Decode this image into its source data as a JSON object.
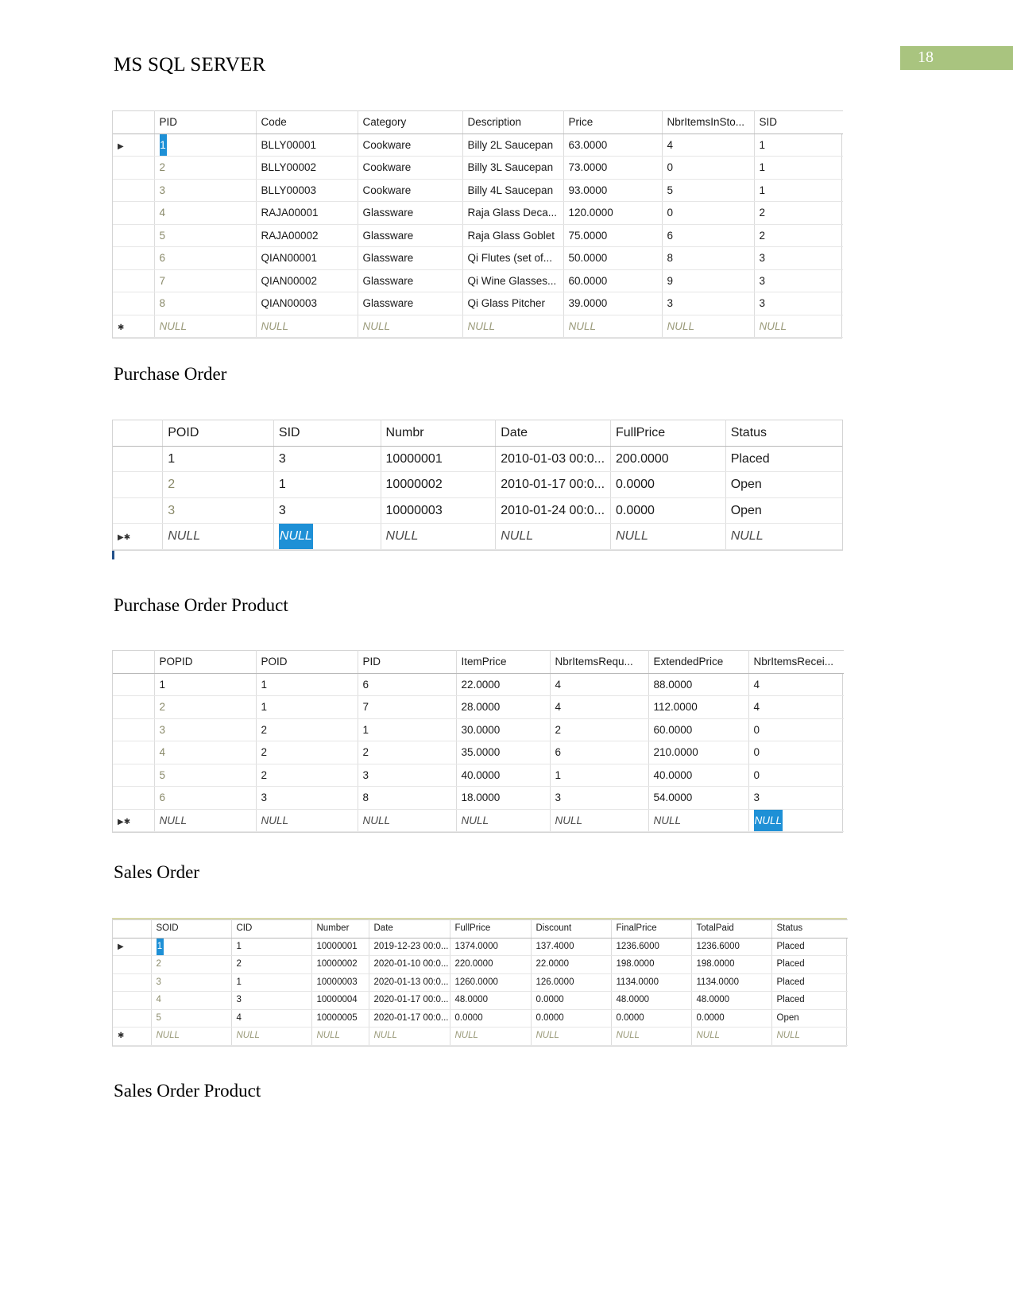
{
  "header": {
    "doc_title": "MS SQL SERVER",
    "page_number": "18",
    "accent_color": "#A9C47F"
  },
  "captions": {
    "purchase_order": "Purchase Order",
    "purchase_order_product": "Purchase Order Product",
    "sales_order": "Sales Order",
    "sales_order_product": "Sales Order Product"
  },
  "tables": {
    "product": {
      "columns": [
        "PID",
        "Code",
        "Category",
        "Description",
        "Price",
        "NbrItemsInSto...",
        "SID"
      ],
      "rows": [
        {
          "selector": "▶",
          "selected_cell": 0,
          "cells": [
            "1",
            "BLLY00001",
            "Cookware",
            "Billy 2L Saucepan",
            "63.0000",
            "4",
            "1"
          ]
        },
        {
          "selector": "",
          "selected_cell": -1,
          "cells": [
            "2",
            "BLLY00002",
            "Cookware",
            "Billy 3L Saucepan",
            "73.0000",
            "0",
            "1"
          ]
        },
        {
          "selector": "",
          "selected_cell": -1,
          "cells": [
            "3",
            "BLLY00003",
            "Cookware",
            "Billy 4L Saucepan",
            "93.0000",
            "5",
            "1"
          ]
        },
        {
          "selector": "",
          "selected_cell": -1,
          "cells": [
            "4",
            "RAJA00001",
            "Glassware",
            "Raja Glass Deca...",
            "120.0000",
            "0",
            "2"
          ]
        },
        {
          "selector": "",
          "selected_cell": -1,
          "cells": [
            "5",
            "RAJA00002",
            "Glassware",
            "Raja Glass Goblet",
            "75.0000",
            "6",
            "2"
          ]
        },
        {
          "selector": "",
          "selected_cell": -1,
          "cells": [
            "6",
            "QIAN00001",
            "Glassware",
            "Qi Flutes (set of...",
            "50.0000",
            "8",
            "3"
          ]
        },
        {
          "selector": "",
          "selected_cell": -1,
          "cells": [
            "7",
            "QIAN00002",
            "Glassware",
            "Qi Wine Glasses...",
            "60.0000",
            "9",
            "3"
          ]
        },
        {
          "selector": "",
          "selected_cell": -1,
          "cells": [
            "8",
            "QIAN00003",
            "Glassware",
            "Qi Glass Pitcher",
            "39.0000",
            "3",
            "3"
          ]
        },
        {
          "selector": "✱",
          "selected_cell": -1,
          "cells": [
            "NULL",
            "NULL",
            "NULL",
            "NULL",
            "NULL",
            "NULL",
            "NULL"
          ]
        }
      ]
    },
    "purchase_order": {
      "columns": [
        "POID",
        "SID",
        "Numbr",
        "Date",
        "FullPrice",
        "Status"
      ],
      "rows": [
        {
          "selector": "",
          "selected_cell": -1,
          "cells": [
            "1",
            "3",
            "10000001",
            "2010-01-03 00:0...",
            "200.0000",
            "Placed"
          ]
        },
        {
          "selector": "",
          "selected_cell": -1,
          "cells": [
            "2",
            "1",
            "10000002",
            "2010-01-17 00:0...",
            "0.0000",
            "Open"
          ]
        },
        {
          "selector": "",
          "selected_cell": -1,
          "cells": [
            "3",
            "3",
            "10000003",
            "2010-01-24 00:0...",
            "0.0000",
            "Open"
          ]
        },
        {
          "selector": "▶✱",
          "selected_cell": 1,
          "cells": [
            "NULL",
            "NULL",
            "NULL",
            "NULL",
            "NULL",
            "NULL"
          ]
        }
      ]
    },
    "purchase_order_product": {
      "columns": [
        "POPID",
        "POID",
        "PID",
        "ItemPrice",
        "NbrItemsRequ...",
        "ExtendedPrice",
        "NbrItemsRecei..."
      ],
      "rows": [
        {
          "selector": "",
          "selected_cell": -1,
          "cells": [
            "1",
            "1",
            "6",
            "22.0000",
            "4",
            "88.0000",
            "4"
          ]
        },
        {
          "selector": "",
          "selected_cell": -1,
          "cells": [
            "2",
            "1",
            "7",
            "28.0000",
            "4",
            "112.0000",
            "4"
          ]
        },
        {
          "selector": "",
          "selected_cell": -1,
          "cells": [
            "3",
            "2",
            "1",
            "30.0000",
            "2",
            "60.0000",
            "0"
          ]
        },
        {
          "selector": "",
          "selected_cell": -1,
          "cells": [
            "4",
            "2",
            "2",
            "35.0000",
            "6",
            "210.0000",
            "0"
          ]
        },
        {
          "selector": "",
          "selected_cell": -1,
          "cells": [
            "5",
            "2",
            "3",
            "40.0000",
            "1",
            "40.0000",
            "0"
          ]
        },
        {
          "selector": "",
          "selected_cell": -1,
          "cells": [
            "6",
            "3",
            "8",
            "18.0000",
            "3",
            "54.0000",
            "3"
          ]
        },
        {
          "selector": "▶✱",
          "selected_cell": 6,
          "cells": [
            "NULL",
            "NULL",
            "NULL",
            "NULL",
            "NULL",
            "NULL",
            "NULL"
          ]
        }
      ]
    },
    "sales_order": {
      "columns": [
        "SOID",
        "CID",
        "Number",
        "Date",
        "FullPrice",
        "Discount",
        "FinalPrice",
        "TotalPaid",
        "Status"
      ],
      "rows": [
        {
          "selector": "▶",
          "selected_cell": 0,
          "cells": [
            "1",
            "1",
            "10000001",
            "2019-12-23 00:0...",
            "1374.0000",
            "137.4000",
            "1236.6000",
            "1236.6000",
            "Placed"
          ]
        },
        {
          "selector": "",
          "selected_cell": -1,
          "cells": [
            "2",
            "2",
            "10000002",
            "2020-01-10 00:0...",
            "220.0000",
            "22.0000",
            "198.0000",
            "198.0000",
            "Placed"
          ]
        },
        {
          "selector": "",
          "selected_cell": -1,
          "cells": [
            "3",
            "1",
            "10000003",
            "2020-01-13 00:0...",
            "1260.0000",
            "126.0000",
            "1134.0000",
            "1134.0000",
            "Placed"
          ]
        },
        {
          "selector": "",
          "selected_cell": -1,
          "cells": [
            "4",
            "3",
            "10000004",
            "2020-01-17 00:0...",
            "48.0000",
            "0.0000",
            "48.0000",
            "48.0000",
            "Placed"
          ]
        },
        {
          "selector": "",
          "selected_cell": -1,
          "cells": [
            "5",
            "4",
            "10000005",
            "2020-01-17 00:0...",
            "0.0000",
            "0.0000",
            "0.0000",
            "0.0000",
            "Open"
          ]
        },
        {
          "selector": "✱",
          "selected_cell": -1,
          "cells": [
            "NULL",
            "NULL",
            "NULL",
            "NULL",
            "NULL",
            "NULL",
            "NULL",
            "NULL",
            "NULL"
          ]
        }
      ]
    }
  }
}
